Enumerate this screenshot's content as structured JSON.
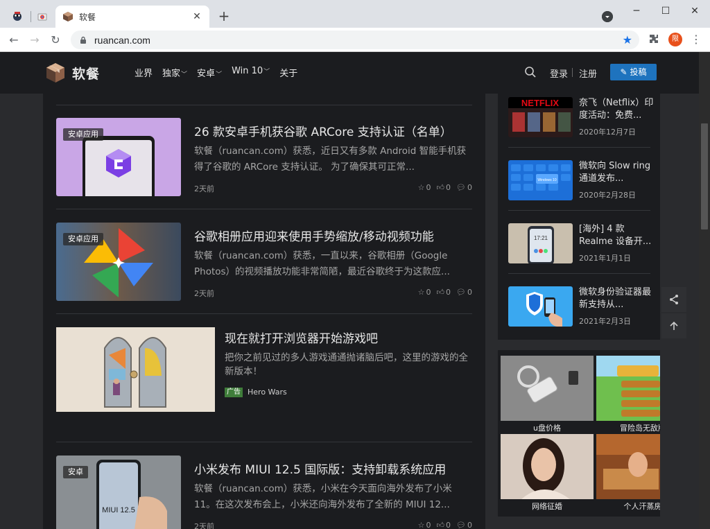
{
  "browser": {
    "tab_title": "软餐",
    "url": "ruancan.com",
    "avatar_letter": "限"
  },
  "site": {
    "logo_text": "软餐",
    "nav": [
      {
        "label": "业界",
        "dropdown": false
      },
      {
        "label": "独家",
        "dropdown": true
      },
      {
        "label": "安卓",
        "dropdown": true
      },
      {
        "label": "Win 10",
        "dropdown": true
      },
      {
        "label": "关于",
        "dropdown": false
      }
    ],
    "login": "登录",
    "register": "注册",
    "submit": "投稿"
  },
  "posts": [
    {
      "tag": "安卓应用",
      "title": "26 款安卓手机获谷歌 ARCore 支持认证（名单）",
      "excerpt": "软餐（ruancan.com）获悉，近日又有多款 Android 智能手机获得了谷歌的 ARCore 支持认证。 为了确保其可正常...",
      "time": "2天前",
      "stars": "0",
      "likes": "0",
      "comments": "0"
    },
    {
      "tag": "安卓应用",
      "title": "谷歌相册应用迎来使用手势缩放/移动视频功能",
      "excerpt": "软餐（ruancan.com）获悉，一直以来，谷歌相册（Google Photos）的视频播放功能非常简陋，最近谷歌终于为这款应...",
      "time": "2天前",
      "stars": "0",
      "likes": "0",
      "comments": "0"
    },
    {
      "tag": "安卓",
      "title": "小米发布 MIUI 12.5 国际版：支持卸载系统应用",
      "excerpt": "软餐（ruancan.com）获悉，小米在今天面向海外发布了小米 11。在这次发布会上，小米还向海外发布了全新的 MIUI 12...",
      "time": "2天前",
      "stars": "0",
      "likes": "0",
      "comments": "0",
      "thumb_text": "MIUI 12.5"
    }
  ],
  "ad_post": {
    "title": "现在就打开浏览器开始游戏吧",
    "text": "把你之前见过的多人游戏通通抛诸脑后吧，这里的游戏的全新版本！",
    "badge": "广告",
    "sponsor": "Hero Wars"
  },
  "sidebar": [
    {
      "title": "奈飞（Netflix）印度活动：免费...",
      "date": "2020年12月7日",
      "thumb_text": "NETFLIX"
    },
    {
      "title": "微软向 Slow ring 通道发布...",
      "date": "2020年2月28日",
      "thumb_text": "Windows 10"
    },
    {
      "title": "[海外] 4 款 Realme 设备开...",
      "date": "2021年1月1日",
      "thumb_text": "17:21"
    },
    {
      "title": "微软身份验证器最新支持从...",
      "date": "2021年2月3日"
    }
  ],
  "ad_grid": [
    {
      "label": "u盘价格"
    },
    {
      "label": "冒险岛无敌版"
    },
    {
      "label": "网络征婚"
    },
    {
      "label": "个人汗蒸房"
    }
  ],
  "colors": {
    "accent": "#1e73be",
    "page_bg": "#2a2b2e",
    "card_bg": "#1b1c1f",
    "ad_badge": "#3f7d3a"
  }
}
